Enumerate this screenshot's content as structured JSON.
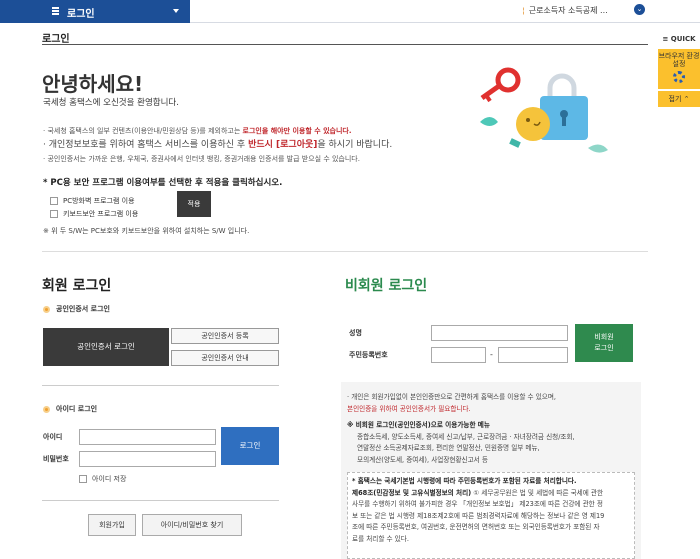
{
  "topbar": {
    "nav_title": "로그인",
    "right_dropdown": "근로소득자 소득공제 ...",
    "right_marker": "¦"
  },
  "quick": {
    "header": "≡ QUICK",
    "box_label": "브라우저 환경설정",
    "close_label": "접기 ⌃"
  },
  "page": {
    "title": "로그인",
    "greeting": "안녕하세요!",
    "welcome": "국세청 홈택스에 오신것을 환영합니다.",
    "note1_a": "· 국세청 홈택스의 일부 컨텐츠(이용안내/민원상담 등)를 제외하고는 ",
    "note1_b": "로그인을 해야만 이용할 수 있습니다.",
    "note2_a": "· 개인정보보호를 위하여 홈택스 서비스를 이용하신 후 ",
    "note2_b": "반드시 [로그아웃]",
    "note2_c": "을 하시기 바랍니다.",
    "note3": "· 공인인증서는 가까운 은행, 우체국, 증권사에서 인터넷 뱅킹, 증권거래용 인증서를 발급 받으실 수 있습니다."
  },
  "pc_security": {
    "title": "* PC용 보안 프로그램 이용여부를 선택한 후 적용을 클릭하십시오.",
    "option1": "PC방화벽 프로그램 이용",
    "option2": "키보드보안 프로그램 이용",
    "apply": "적용",
    "note": "※ 위 두 S/W는 PC보호와 키보드보안을 위하여 설치하는 S/W 입니다."
  },
  "member": {
    "heading": "회원 로그인",
    "cert_section": "공인인증서 로그인",
    "cert_login": "공인인증서 로그인",
    "cert_register": "공인인증서 등록",
    "cert_guide": "공인인증서 안내",
    "id_section": "아이디 로그인",
    "id_label": "아이디",
    "pw_label": "비밀번호",
    "login_button": "로그인",
    "save_id": "아이디 저장",
    "join": "회원가입",
    "find": "아이디/비밀번호 찾기"
  },
  "nonmember": {
    "heading": "비회원 로그인",
    "name_label": "성명",
    "rrn_label": "주민등록번호",
    "dash": "-",
    "login_button_line1": "비회원",
    "login_button_line2": "로그인",
    "info1": "· 개인은 회원가입없이 본인인증만으로 간편하게 홈택스를 이용할 수 있으며,",
    "info1_red": "본인인증을 위하여 공인인증서가 필요합니다.",
    "info2_title": "※ 비회원 로그인(공인인증서)으로 이용가능한 메뉴",
    "info2_line1": "종합소득세, 양도소득세, 증여세 신고/납부, 근로장려금 · 자녀장려금 신청/조회,",
    "info2_line2": "연말정산 소득공제자료조회, 편리한 연말정산, 민원증명 일부 메뉴,",
    "info2_line3": "모의계산(양도세, 증여세), 사업장현황신고서 등",
    "inner_title": "* 홈택스는 국세기본법 시행령에 따라 주민등록번호가 포함된 자료를 처리합니다.",
    "inner_b": "제68조(민감정보 및 고유식별정보의 처리)",
    "inner_body1": " ① 세무공무원은 법 및 세법에 따른 국세에 관한",
    "inner_body2": "사무를 수행하기 위하여 불가피한 경우 「개인정보 보호법」 제23조에 따른 건강에 관한 정",
    "inner_body3": "보 또는 같은 법 시행령 제18조제2호에 따른 범죄경력자료에 해당하는 정보나 같은 영 제19",
    "inner_body4": "조에 따른 주민등록번호, 여권번호, 운전면허의 면허번호 또는 외국인등록번호가 포함된 자",
    "inner_body5": "료를 처리할 수 있다."
  },
  "colors": {
    "nav_blue": "#1c4f97",
    "login_blue": "#2f6fc0",
    "nonmember_green": "#2f8a4e",
    "quick_yellow": "#fbc02d",
    "alert_red": "#c0282d"
  }
}
